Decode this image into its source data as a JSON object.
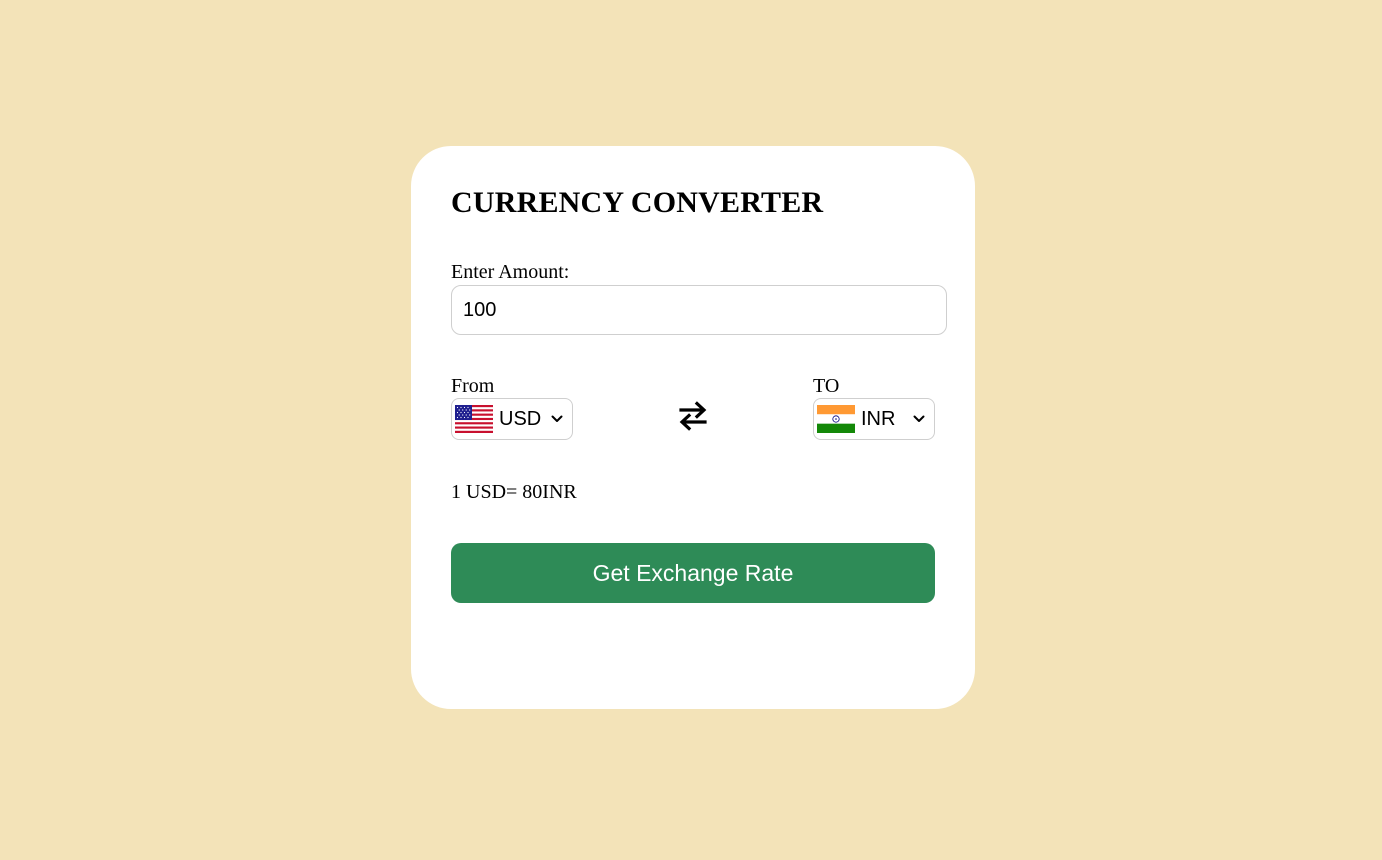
{
  "title": "CURRENCY CONVERTER",
  "amount": {
    "label": "Enter Amount:",
    "value": "100"
  },
  "from": {
    "label": "From",
    "currency": "USD",
    "flag_icon": "us-flag-icon"
  },
  "to": {
    "label": "TO",
    "currency": "INR",
    "flag_icon": "india-flag-icon"
  },
  "swap_icon": "swap-arrows-icon",
  "rate_text": "1 USD= 80INR",
  "button_label": "Get Exchange Rate",
  "colors": {
    "background": "#f3e3b8",
    "card": "#ffffff",
    "button": "#2e8b57",
    "button_text": "#ffffff"
  }
}
